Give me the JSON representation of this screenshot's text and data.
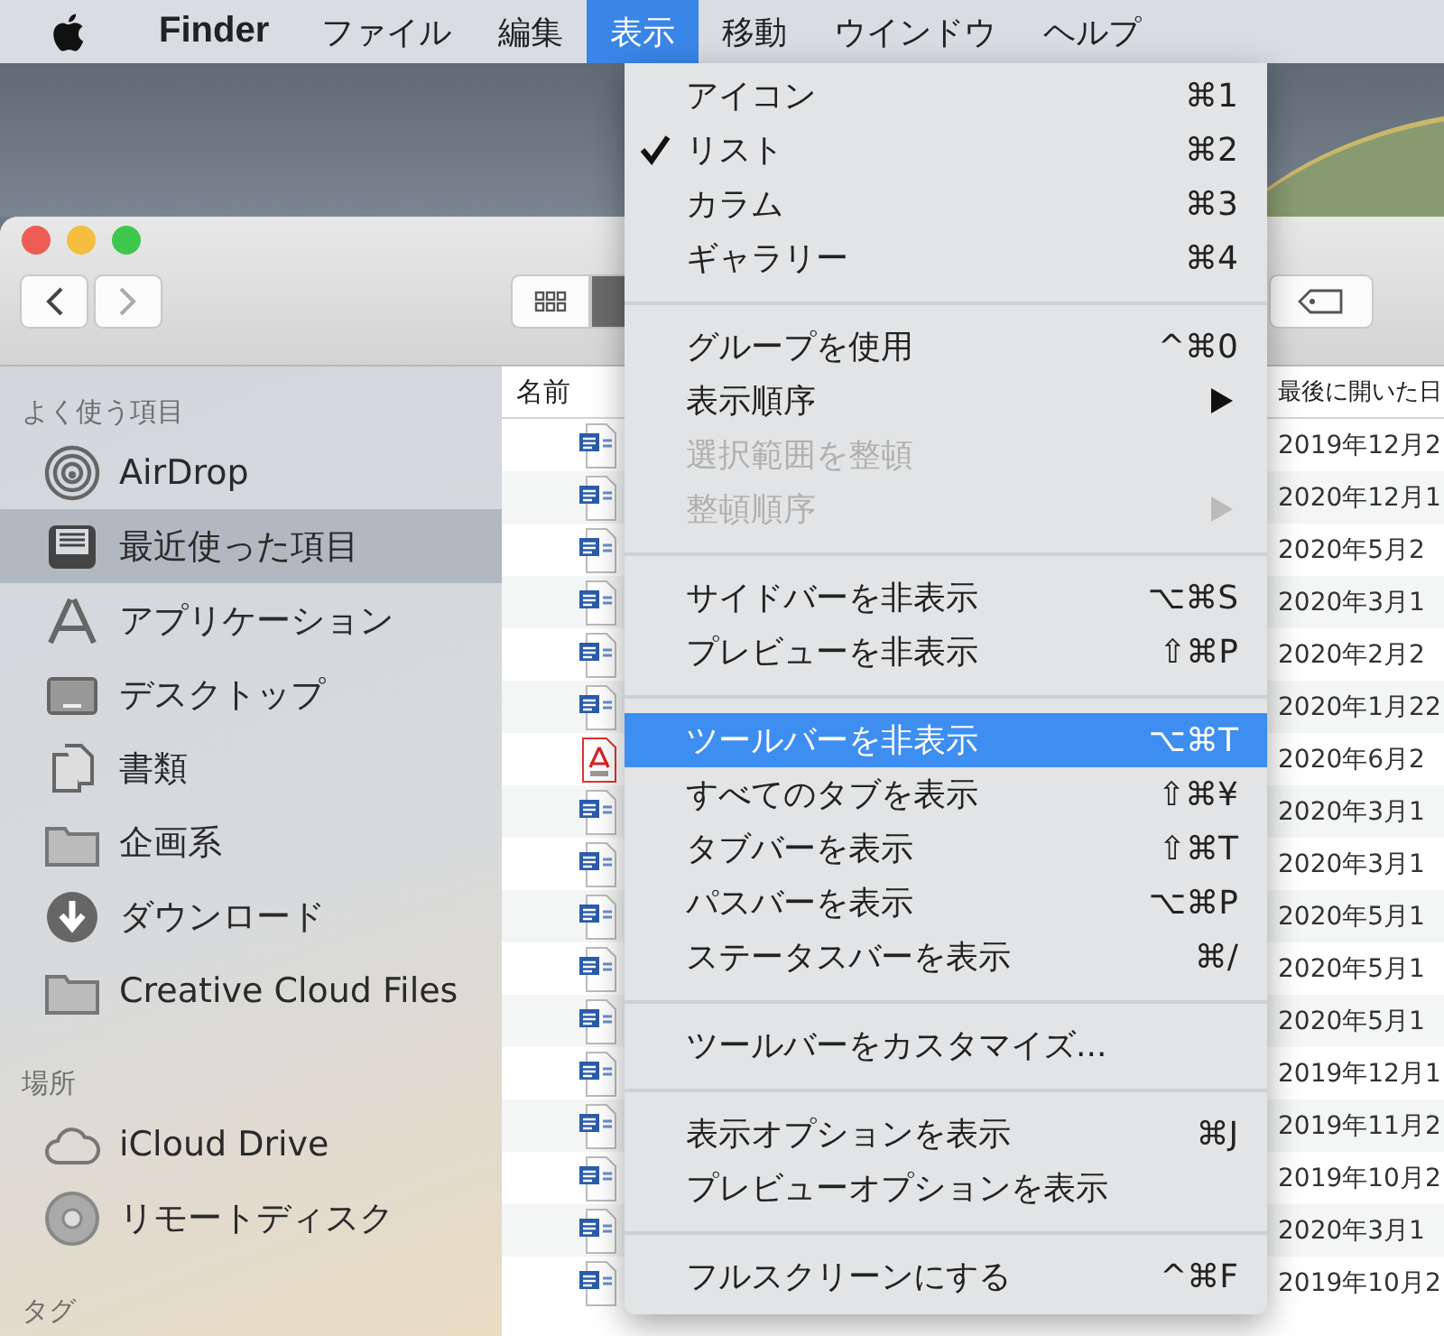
{
  "menubar": {
    "app": "Finder",
    "items": [
      {
        "label": "ファイル",
        "selected": false
      },
      {
        "label": "編集",
        "selected": false
      },
      {
        "label": "表示",
        "selected": true
      },
      {
        "label": "移動",
        "selected": false
      },
      {
        "label": "ウインドウ",
        "selected": false
      },
      {
        "label": "ヘルプ",
        "selected": false
      }
    ]
  },
  "menu": {
    "items": [
      {
        "kind": "item",
        "label": "アイコン",
        "shortcut": "⌘1",
        "checked": false,
        "disabled": false,
        "submenu": false,
        "selected": false
      },
      {
        "kind": "item",
        "label": "リスト",
        "shortcut": "⌘2",
        "checked": true,
        "disabled": false,
        "submenu": false,
        "selected": false
      },
      {
        "kind": "item",
        "label": "カラム",
        "shortcut": "⌘3",
        "checked": false,
        "disabled": false,
        "submenu": false,
        "selected": false
      },
      {
        "kind": "item",
        "label": "ギャラリー",
        "shortcut": "⌘4",
        "checked": false,
        "disabled": false,
        "submenu": false,
        "selected": false
      },
      {
        "kind": "separator"
      },
      {
        "kind": "item",
        "label": "グループを使用",
        "shortcut": "^⌘0",
        "checked": false,
        "disabled": false,
        "submenu": false,
        "selected": false
      },
      {
        "kind": "item",
        "label": "表示順序",
        "checked": false,
        "disabled": false,
        "submenu": true,
        "selected": false
      },
      {
        "kind": "item",
        "label": "選択範囲を整頓",
        "checked": false,
        "disabled": true,
        "submenu": false,
        "selected": false
      },
      {
        "kind": "item",
        "label": "整頓順序",
        "checked": false,
        "disabled": true,
        "submenu": true,
        "selected": false
      },
      {
        "kind": "separator"
      },
      {
        "kind": "item",
        "label": "サイドバーを非表示",
        "shortcut": "⌥⌘S",
        "checked": false,
        "disabled": false,
        "submenu": false,
        "selected": false
      },
      {
        "kind": "item",
        "label": "プレビューを非表示",
        "shortcut": "⇧⌘P",
        "checked": false,
        "disabled": false,
        "submenu": false,
        "selected": false
      },
      {
        "kind": "separator"
      },
      {
        "kind": "item",
        "label": "ツールバーを非表示",
        "shortcut": "⌥⌘T",
        "checked": false,
        "disabled": false,
        "submenu": false,
        "selected": true
      },
      {
        "kind": "item",
        "label": "すべてのタブを表示",
        "shortcut": "⇧⌘¥",
        "checked": false,
        "disabled": false,
        "submenu": false,
        "selected": false
      },
      {
        "kind": "item",
        "label": "タブバーを表示",
        "shortcut": "⇧⌘T",
        "checked": false,
        "disabled": false,
        "submenu": false,
        "selected": false
      },
      {
        "kind": "item",
        "label": "パスバーを表示",
        "shortcut": "⌥⌘P",
        "checked": false,
        "disabled": false,
        "submenu": false,
        "selected": false
      },
      {
        "kind": "item",
        "label": "ステータスバーを表示",
        "shortcut": "⌘/",
        "checked": false,
        "disabled": false,
        "submenu": false,
        "selected": false
      },
      {
        "kind": "separator"
      },
      {
        "kind": "item",
        "label": "ツールバーをカスタマイズ...",
        "checked": false,
        "disabled": false,
        "submenu": false,
        "selected": false
      },
      {
        "kind": "separator"
      },
      {
        "kind": "item",
        "label": "表示オプションを表示",
        "shortcut": "⌘J",
        "checked": false,
        "disabled": false,
        "submenu": false,
        "selected": false
      },
      {
        "kind": "item",
        "label": "プレビューオプションを表示",
        "checked": false,
        "disabled": false,
        "submenu": false,
        "selected": false
      },
      {
        "kind": "separator"
      },
      {
        "kind": "item",
        "label": "フルスクリーンにする",
        "shortcut": "^⌘F",
        "checked": false,
        "disabled": false,
        "submenu": false,
        "selected": false
      }
    ]
  },
  "sidebar": {
    "sections": [
      {
        "title": "よく使う項目",
        "items": [
          {
            "label": "AirDrop",
            "selected": false
          },
          {
            "label": "最近使った項目",
            "selected": true
          },
          {
            "label": "アプリケーション",
            "selected": false
          },
          {
            "label": "デスクトップ",
            "selected": false
          },
          {
            "label": "書類",
            "selected": false
          },
          {
            "label": "企画系",
            "selected": false
          },
          {
            "label": "ダウンロード",
            "selected": false
          },
          {
            "label": "Creative Cloud Files",
            "selected": false
          }
        ]
      },
      {
        "title": "場所",
        "items": [
          {
            "label": "iCloud Drive",
            "selected": false
          },
          {
            "label": "リモートディスク",
            "selected": false
          }
        ]
      },
      {
        "title": "タグ"
      }
    ]
  },
  "table": {
    "columns": [
      "名前",
      "最後に開いた日"
    ],
    "rows": [
      {
        "kind": "word",
        "date": "2019年12月2"
      },
      {
        "kind": "word",
        "date": "2020年12月1"
      },
      {
        "kind": "word",
        "date": "2020年5月2"
      },
      {
        "kind": "word",
        "date": "2020年3月1"
      },
      {
        "kind": "word",
        "date": "2020年2月2"
      },
      {
        "kind": "word",
        "date": "2020年1月22"
      },
      {
        "kind": "pdf",
        "date": "2020年6月2"
      },
      {
        "kind": "word",
        "date": "2020年3月1"
      },
      {
        "kind": "word",
        "date": "2020年3月1"
      },
      {
        "kind": "word",
        "date": "2020年5月1"
      },
      {
        "kind": "word",
        "date": "2020年5月1"
      },
      {
        "kind": "word",
        "date": "2020年5月1"
      },
      {
        "kind": "word",
        "date": "2019年12月1"
      },
      {
        "kind": "word",
        "date": "2019年11月2"
      },
      {
        "kind": "word",
        "date": "2019年10月2"
      },
      {
        "kind": "word",
        "date": "2020年3月1"
      },
      {
        "kind": "word",
        "date": "2019年10月2"
      }
    ]
  }
}
